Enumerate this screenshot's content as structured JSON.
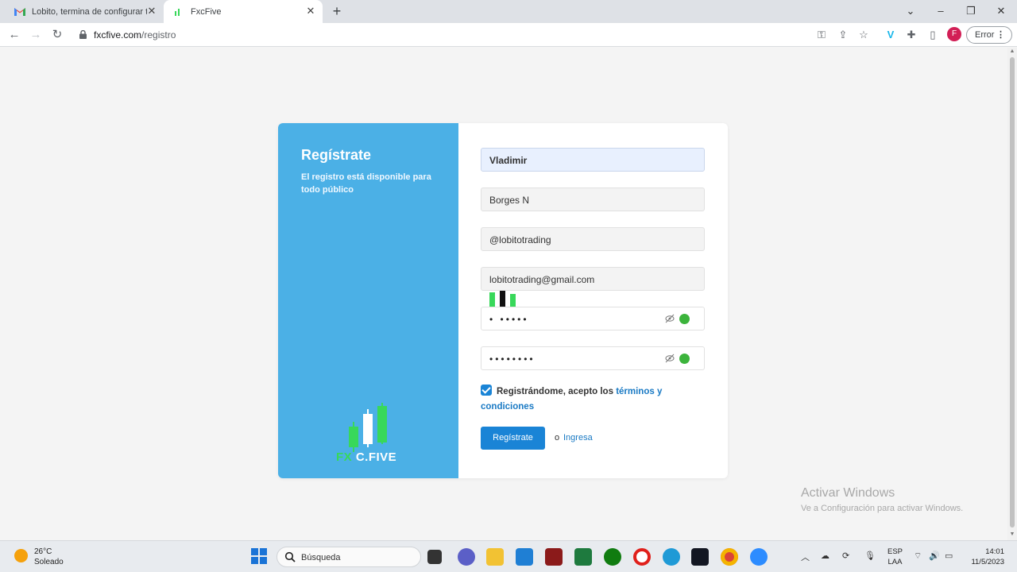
{
  "browser": {
    "tabs": [
      {
        "title": "Lobito, termina de configurar tu",
        "favicon": "gmail-icon"
      },
      {
        "title": "FxcFive",
        "favicon": "fxcfive-icon"
      }
    ],
    "url_host": "fxcfive.com",
    "url_path": "/registro",
    "profile_initial": "F",
    "error_label": "Error"
  },
  "page": {
    "panel_title": "Regístrate",
    "panel_subtitle": "El registro está disponible para todo público",
    "logo_fx": "FX",
    "logo_cfive": "C.FIVE",
    "fields": {
      "first_name": "Vladimir",
      "last_name": "Borges N",
      "username": "@lobitotrading",
      "email": "lobitotrading@gmail.com",
      "password_mask": "• •••••",
      "confirm_mask": "••••••••"
    },
    "terms_text": "Registrándome, acepto los ",
    "terms_link": "términos y condiciones",
    "submit_label": "Regístrate",
    "or_text": "o",
    "login_link": "Ingresa"
  },
  "watermark": {
    "line1": "Activar Windows",
    "line2": "Ve a Configuración para activar Windows."
  },
  "taskbar": {
    "temperature": "26°C",
    "condition": "Soleado",
    "search_placeholder": "Búsqueda",
    "lang_top": "ESP",
    "lang_bottom": "LAA",
    "time": "14:01",
    "date": "11/5/2023"
  },
  "colors": {
    "panel_blue": "#4bb0e6",
    "button_blue": "#1a84d6",
    "logo_green": "#38d85a"
  }
}
